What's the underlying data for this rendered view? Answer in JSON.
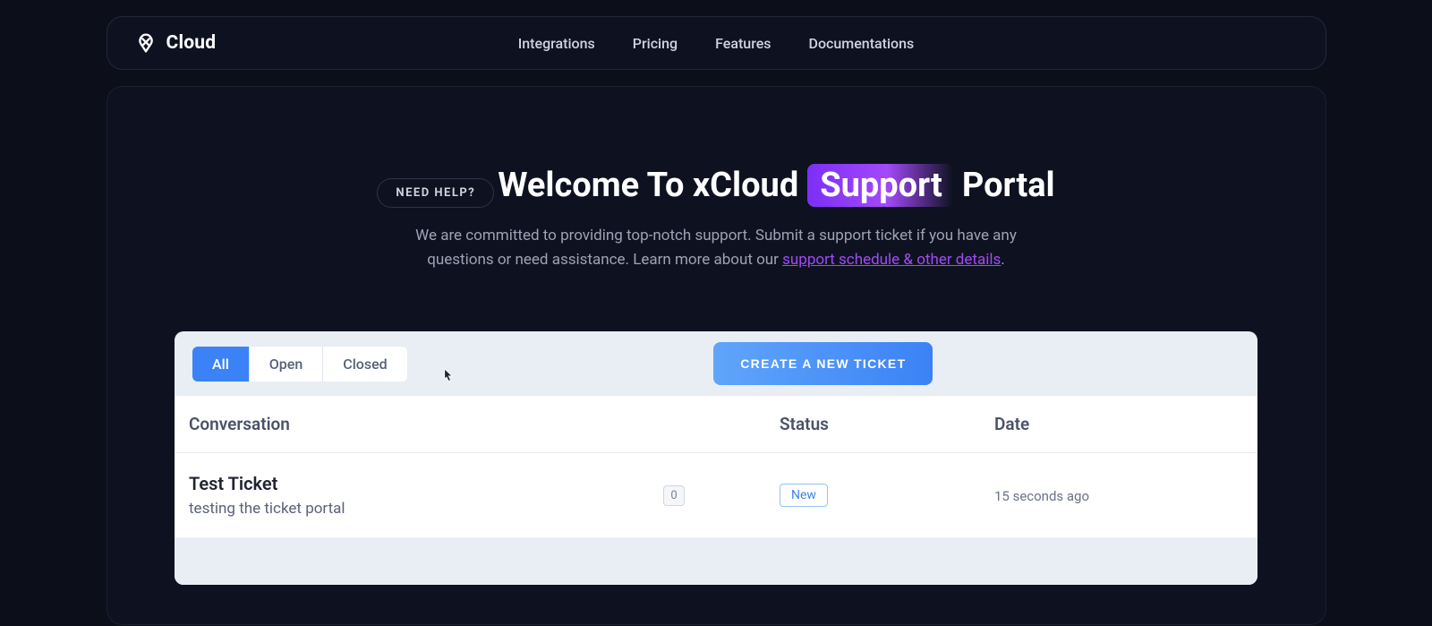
{
  "brand": {
    "name": "Cloud"
  },
  "nav": {
    "integrations": "Integrations",
    "pricing": "Pricing",
    "features": "Features",
    "documentations": "Documentations"
  },
  "hero": {
    "pill": "NEED HELP?",
    "title_pre": "Welcome To xCloud",
    "title_highlight": "Support",
    "title_post": "Portal",
    "subtitle_a": "We are committed to providing top-notch support. Submit a support ticket if you have any questions or need assistance. Learn more about our ",
    "subtitle_link": "support schedule & other details",
    "subtitle_b": "."
  },
  "tabs": {
    "all": "All",
    "open": "Open",
    "closed": "Closed"
  },
  "buttons": {
    "create_ticket": "CREATE A NEW TICKET"
  },
  "table": {
    "headers": {
      "conversation": "Conversation",
      "status": "Status",
      "date": "Date"
    },
    "rows": [
      {
        "title": "Test Ticket",
        "description": "testing the ticket portal",
        "count": "0",
        "status": "New",
        "date": "15 seconds ago"
      }
    ]
  }
}
